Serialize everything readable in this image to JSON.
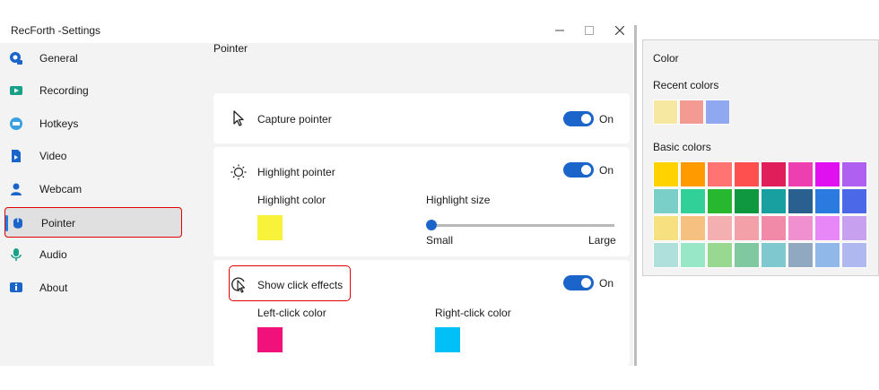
{
  "window": {
    "title": "RecForth -Settings"
  },
  "sidebar": {
    "items": [
      {
        "label": "General",
        "icon": "general-icon",
        "color": "#1b64c9"
      },
      {
        "label": "Recording",
        "icon": "recording-icon",
        "color": "#19a088"
      },
      {
        "label": "Hotkeys",
        "icon": "hotkeys-icon",
        "color": "#3aa0e0"
      },
      {
        "label": "Video",
        "icon": "video-icon",
        "color": "#1b64c9"
      },
      {
        "label": "Webcam",
        "icon": "webcam-icon",
        "color": "#1b64c9"
      },
      {
        "label": "Pointer",
        "icon": "pointer-icon",
        "color": "#1b64c9"
      },
      {
        "label": "Audio",
        "icon": "audio-icon",
        "color": "#19a088"
      },
      {
        "label": "About",
        "icon": "about-icon",
        "color": "#1b64c9"
      }
    ],
    "active_index": 5
  },
  "main": {
    "heading": "Pointer",
    "capture": {
      "label": "Capture pointer",
      "toggle": "On"
    },
    "highlight": {
      "label": "Highlight pointer",
      "toggle": "On",
      "color_label": "Highlight color",
      "color": "#f8f23a",
      "size_label": "Highlight size",
      "size_min": "Small",
      "size_max": "Large",
      "size_value": 0
    },
    "click": {
      "label": "Show click effects",
      "toggle": "On",
      "left_label": "Left-click color",
      "left_color": "#f0117a",
      "right_label": "Right-click color",
      "right_color": "#00c0f8"
    }
  },
  "color_picker": {
    "title": "Color",
    "recent_label": "Recent colors",
    "recent": [
      "#f6e8a0",
      "#f39a93",
      "#8fa8f0"
    ],
    "basic_label": "Basic colors",
    "basic": [
      [
        "#ffd200",
        "#ff9a00",
        "#ff7373",
        "#ff5050",
        "#e01f5a",
        "#ee3fb0",
        "#e010f0",
        "#b060f0"
      ],
      [
        "#7ad0c8",
        "#30d098",
        "#28b830",
        "#109840",
        "#18a0a0",
        "#2a6090",
        "#2a7ae0",
        "#4a68e8"
      ],
      [
        "#f6e080",
        "#f5c080",
        "#f4b0b0",
        "#f4a0a8",
        "#f08aa8",
        "#f090d0",
        "#e888f8",
        "#c8a0f0"
      ],
      [
        "#b0e0dc",
        "#98e8c8",
        "#98d890",
        "#80c8a0",
        "#80c8d0",
        "#90a8c0",
        "#90b8e8",
        "#b0b8f0"
      ]
    ]
  }
}
